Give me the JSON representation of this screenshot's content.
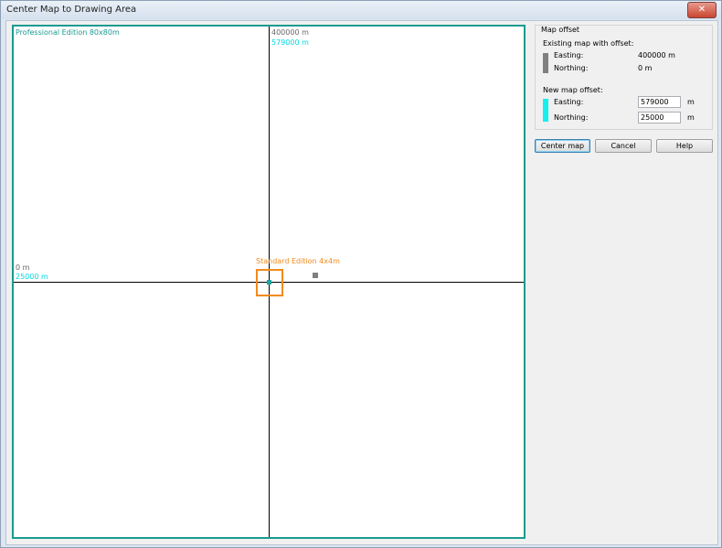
{
  "window": {
    "title": "Center Map to Drawing Area",
    "close_glyph": "✕"
  },
  "canvas": {
    "pro_label": "Professional Edition 80x80m",
    "top_existing_easting": "400000 m",
    "top_new_easting": "579000 m",
    "left_existing_northing": "0 m",
    "left_new_northing": "25000 m",
    "standard_label": "Standard Edition 4x4m"
  },
  "map_offset": {
    "title": "Map offset",
    "existing_title": "Existing map with offset:",
    "existing_easting_label": "Easting:",
    "existing_easting_value": "400000 m",
    "existing_northing_label": "Northing:",
    "existing_northing_value": "0 m",
    "new_title": "New map offset:",
    "new_easting_label": "Easting:",
    "new_easting_value": "579000",
    "new_easting_unit": "m",
    "new_northing_label": "Northing:",
    "new_northing_value": "25000",
    "new_northing_unit": "m"
  },
  "buttons": {
    "center": "Center map",
    "cancel": "Cancel",
    "help": "Help"
  },
  "colors": {
    "pro_border": "#1a9a90",
    "existing_marker": "#808080",
    "new_marker": "#14f0f0",
    "standard_box": "#f28a1c"
  }
}
